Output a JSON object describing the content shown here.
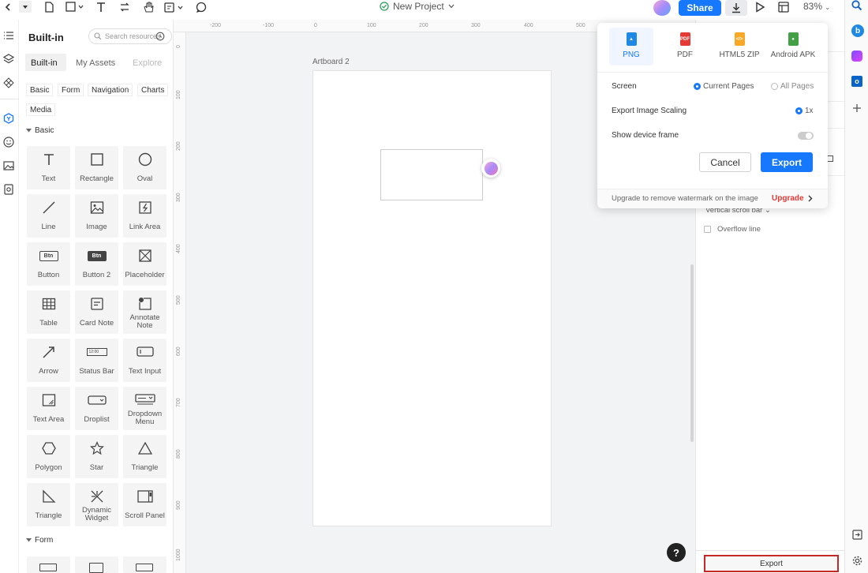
{
  "topbar": {
    "project_name": "New Project",
    "share_label": "Share",
    "zoom": "83%"
  },
  "panel": {
    "title": "Built-in",
    "search_placeholder": "Search resources",
    "tabs": [
      "Built-in",
      "My Assets",
      "Explore"
    ],
    "chips": [
      "Basic",
      "Form",
      "Navigation",
      "Charts",
      "Media"
    ],
    "section_basic": "Basic",
    "section_form": "Form",
    "tiles": [
      {
        "label": "Text",
        "icon": "text-icon"
      },
      {
        "label": "Rectangle",
        "icon": "rectangle-icon"
      },
      {
        "label": "Oval",
        "icon": "oval-icon"
      },
      {
        "label": "Line",
        "icon": "line-icon"
      },
      {
        "label": "Image",
        "icon": "image-icon"
      },
      {
        "label": "Link Area",
        "icon": "link-area-icon"
      },
      {
        "label": "Button",
        "icon": "button-icon"
      },
      {
        "label": "Button 2",
        "icon": "button2-icon"
      },
      {
        "label": "Placeholder",
        "icon": "placeholder-icon"
      },
      {
        "label": "Table",
        "icon": "table-icon"
      },
      {
        "label": "Card Note",
        "icon": "card-note-icon"
      },
      {
        "label": "Annotate Note",
        "icon": "annotate-note-icon"
      },
      {
        "label": "Arrow",
        "icon": "arrow-icon"
      },
      {
        "label": "Status Bar",
        "icon": "status-bar-icon"
      },
      {
        "label": "Text Input",
        "icon": "text-input-icon"
      },
      {
        "label": "Text Area",
        "icon": "text-area-icon"
      },
      {
        "label": "Droplist",
        "icon": "droplist-icon"
      },
      {
        "label": "Dropdown Menu",
        "icon": "dropdown-menu-icon"
      },
      {
        "label": "Polygon",
        "icon": "polygon-icon"
      },
      {
        "label": "Star",
        "icon": "star-icon"
      },
      {
        "label": "Triangle",
        "icon": "triangle-icon"
      },
      {
        "label": "Triangle",
        "icon": "right-triangle-icon"
      },
      {
        "label": "Dynamic Widget",
        "icon": "dynamic-widget-icon"
      },
      {
        "label": "Scroll Panel",
        "icon": "scroll-panel-icon"
      }
    ],
    "btn_icon_text": "Btn",
    "status_icon_text": "12:00"
  },
  "canvas": {
    "artboard_label": "Artboard 2",
    "hruler": [
      "-200",
      "-100",
      "0",
      "100",
      "200",
      "300",
      "400",
      "500"
    ],
    "vruler": [
      "0",
      "100",
      "200",
      "300",
      "400",
      "500",
      "600",
      "700",
      "800",
      "900",
      "1000"
    ],
    "help_label": "?"
  },
  "props": {
    "vertical_scroll_bar": "Vertical scroll bar",
    "overflow_line": "Overflow line",
    "export_label": "Export"
  },
  "export_popup": {
    "formats": [
      {
        "label": "PNG",
        "color": "#1e88e5",
        "selected": true
      },
      {
        "label": "PDF",
        "color": "#e53935"
      },
      {
        "label": "HTML5 ZIP",
        "color": "#f9a825"
      },
      {
        "label": "Android APK",
        "color": "#43a047"
      }
    ],
    "screen_label": "Screen",
    "screen_options": [
      "Current Pages",
      "All Pages"
    ],
    "scaling_label": "Export Image Scaling",
    "scaling_value": "1x",
    "device_frame_label": "Show device frame",
    "cancel_label": "Cancel",
    "export_label": "Export",
    "upgrade_text": "Upgrade to remove watermark on the image",
    "upgrade_link": "Upgrade"
  },
  "colors": {
    "accent": "#1677ff",
    "highlight": "#c62828"
  }
}
